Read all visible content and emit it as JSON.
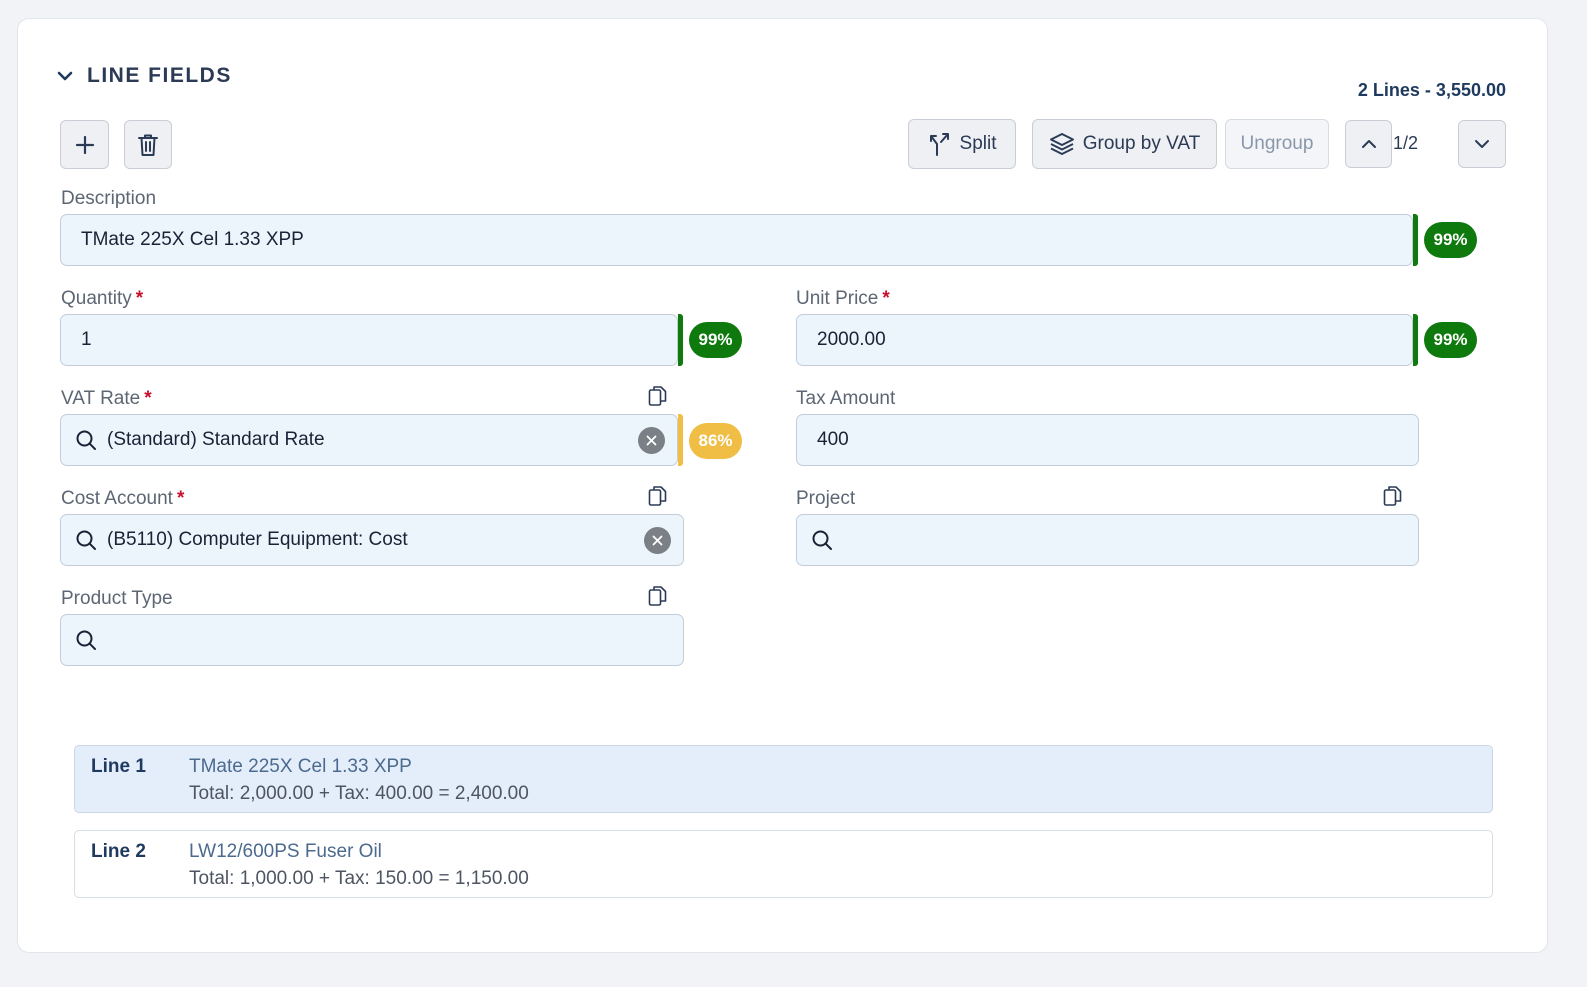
{
  "section": {
    "title": "LINE FIELDS",
    "summary": "2 Lines - 3,550.00"
  },
  "toolbar": {
    "split": "Split",
    "group_by_vat": "Group by VAT",
    "ungroup": "Ungroup",
    "pager": "1/2"
  },
  "fields": {
    "description": {
      "label": "Description",
      "value": "TMate 225X Cel 1.33 XPP",
      "confidence": "99%"
    },
    "quantity": {
      "label": "Quantity",
      "value": "1",
      "confidence": "99%"
    },
    "unit_price": {
      "label": "Unit Price",
      "value": "2000.00",
      "confidence": "99%"
    },
    "vat_rate": {
      "label": "VAT Rate",
      "value": "(Standard) Standard Rate",
      "confidence": "86%"
    },
    "tax_amount": {
      "label": "Tax Amount",
      "value": "400"
    },
    "cost_account": {
      "label": "Cost Account",
      "value": "(B5110) Computer Equipment: Cost"
    },
    "project": {
      "label": "Project",
      "value": ""
    },
    "product_type": {
      "label": "Product Type",
      "value": ""
    }
  },
  "required_marker": "*",
  "lines": [
    {
      "name": "Line 1",
      "description": "TMate 225X Cel 1.33 XPP",
      "total": "Total: 2,000.00 + Tax: 400.00 = 2,400.00",
      "active": true
    },
    {
      "name": "Line 2",
      "description": "LW12/600PS Fuser Oil",
      "total": "Total: 1,000.00 + Tax: 150.00 = 1,150.00",
      "active": false
    }
  ],
  "colors": {
    "confidence_high": "#0e7a0d",
    "confidence_medium": "#f0bd45",
    "field_bg": "#edf5fc",
    "active_line_bg": "#e4eefb"
  },
  "icons": [
    "chevron-down-icon",
    "plus-icon",
    "trash-icon",
    "split-icon",
    "layers-icon",
    "chevron-up-icon",
    "search-icon",
    "clear-icon",
    "copy-icon"
  ]
}
